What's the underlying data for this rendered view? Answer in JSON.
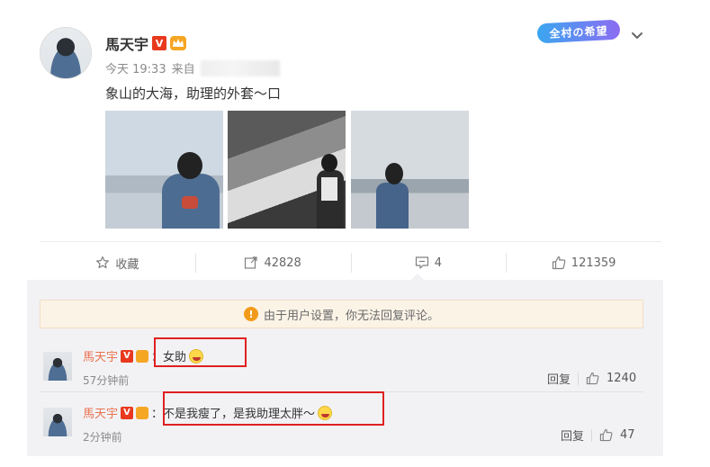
{
  "post": {
    "author": "馬天宇",
    "time": "今天 19:33",
    "source_prefix": "来自",
    "text": "象山的大海，助理的外套～",
    "text_tail": "口",
    "sticker": "全村の希望"
  },
  "actions": {
    "favorite_label": "收藏",
    "repost_count": "42828",
    "comment_count": "4",
    "like_count": "121359"
  },
  "notice": {
    "text": "由于用户设置，你无法回复评论。"
  },
  "comments": [
    {
      "author": "馬天宇",
      "text": "：女助",
      "time": "57分钟前",
      "reply_label": "回复",
      "likes": "1240"
    },
    {
      "author": "馬天宇",
      "text": "：不是我瘦了，是我助理太胖～",
      "time": "2分钟前",
      "reply_label": "回复",
      "likes": "47"
    }
  ],
  "colors": {
    "author_orange": "#eb7350",
    "highlight_red": "#e02020",
    "verified_red": "#e8391e"
  },
  "icons": [
    "star-icon",
    "repost-icon",
    "comment-icon",
    "thumbs-up-icon",
    "warning-icon",
    "chevron-down-icon"
  ]
}
